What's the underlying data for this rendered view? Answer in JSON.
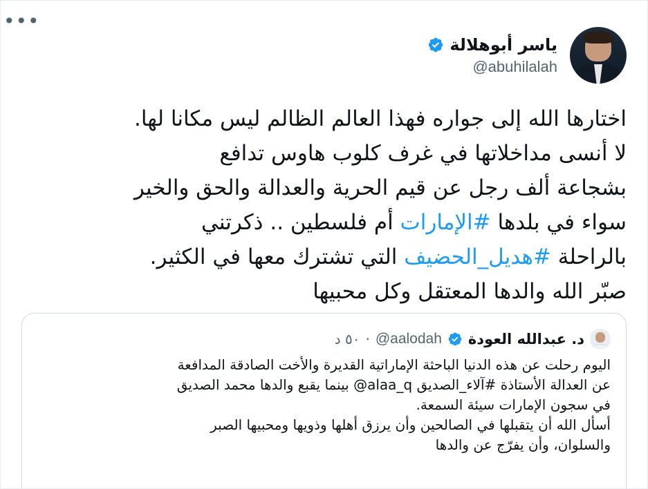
{
  "author": {
    "display_name": "ياسر أبوهلالة",
    "handle": "@abuhilalah"
  },
  "more_label": "•••",
  "body_lines": [
    {
      "text": "اختارها الله إلى جواره فهذا العالم الظالم ليس مكانا لها."
    },
    {
      "text": "لا أنسى مداخلاتها في غرف كلوب هاوس تدافع"
    },
    {
      "text": "بشجاعة ألف رجل عن قيم الحرية والعدالة والحق والخير"
    },
    {
      "before": "سواء في بلدها ",
      "hashtag": "#الإمارات",
      "after": " أم فلسطين .. ذكرتني"
    },
    {
      "before": "بالراحلة ",
      "hashtag": "#هديل_الحضيف",
      "after": " التي تشترك معها في الكثير."
    },
    {
      "text": "صبّر الله والدها المعتقل وكل محبيها"
    }
  ],
  "quote": {
    "display_name": "د. عبدالله العودة",
    "handle": "@aalodah",
    "separator": "·",
    "time": "٥٠ د",
    "lines": [
      "اليوم رحلت عن هذه الدنيا الباحثة الإماراتية القديرة والأخت الصادقة المدافعة",
      "عن العدالة الأستاذة #آلاء_الصديق alaa_q@ بينما يقبع والدها محمد الصديق",
      "في سجون الإمارات سيئة السمعة.",
      "أسأل الله أن يتقبلها في الصالحين وأن يرزق أهلها وذويها ومحبيها الصبر",
      "والسلوان، وأن يفرّج عن والدها"
    ]
  },
  "colors": {
    "accent": "#1d9bf0",
    "text": "#0f1419",
    "secondary": "#536471",
    "border": "#cfd9de"
  },
  "icons": {
    "verified": "verified-badge-icon",
    "more": "more-options-icon"
  }
}
